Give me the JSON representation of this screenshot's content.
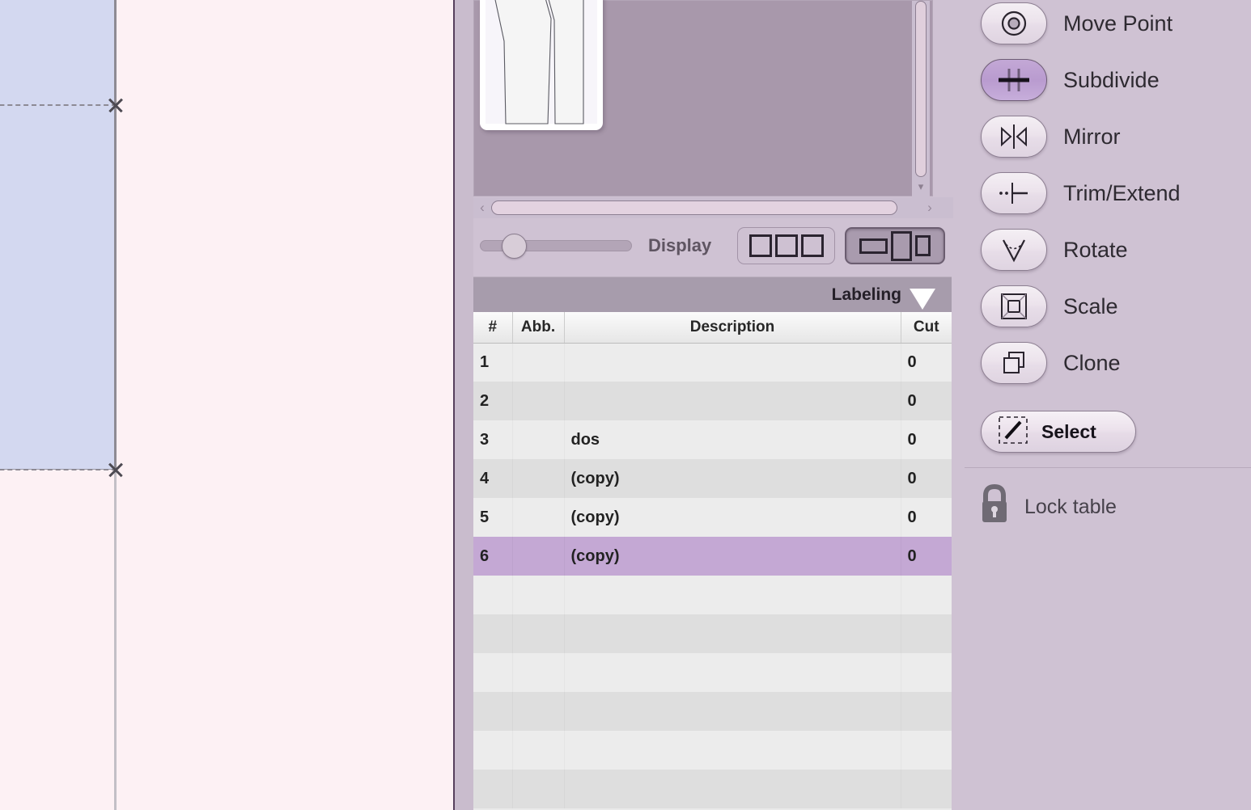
{
  "app": {
    "name": "pattern-layout-editor"
  },
  "canvas": {
    "selection_fill": "#d3d8f0",
    "background": "#fdf1f4",
    "marker_icons": [
      "x-marker",
      "x-marker"
    ]
  },
  "preview": {
    "background": "#a898ab",
    "sheet_label": "",
    "scroll_down_icon": "▾",
    "scroll_left_icon": "‹",
    "scroll_right_icon": "›"
  },
  "display_bar": {
    "label": "Display",
    "slider_value": "15",
    "view_modes": [
      {
        "name": "equal-columns-view",
        "selected": false
      },
      {
        "name": "mixed-columns-view",
        "selected": true
      }
    ]
  },
  "labeling": {
    "title": "Labeling",
    "collapse_icon": "triangle-down"
  },
  "table": {
    "columns": [
      "#",
      "Abb.",
      "Description",
      "Cut"
    ],
    "rows": [
      {
        "num": "1",
        "abb": "",
        "desc": "",
        "cut": "0",
        "selected": false
      },
      {
        "num": "2",
        "abb": "",
        "desc": "",
        "cut": "0",
        "selected": false
      },
      {
        "num": "3",
        "abb": "",
        "desc": "dos",
        "cut": "0",
        "selected": false
      },
      {
        "num": "4",
        "abb": "",
        "desc": "(copy)",
        "cut": "0",
        "selected": false
      },
      {
        "num": "5",
        "abb": "",
        "desc": "(copy)",
        "cut": "0",
        "selected": false
      },
      {
        "num": "6",
        "abb": "",
        "desc": "(copy)",
        "cut": "0",
        "selected": true
      },
      {
        "num": "",
        "abb": "",
        "desc": "",
        "cut": "",
        "selected": false
      },
      {
        "num": "",
        "abb": "",
        "desc": "",
        "cut": "",
        "selected": false
      },
      {
        "num": "",
        "abb": "",
        "desc": "",
        "cut": "",
        "selected": false
      },
      {
        "num": "",
        "abb": "",
        "desc": "",
        "cut": "",
        "selected": false
      },
      {
        "num": "",
        "abb": "",
        "desc": "",
        "cut": "",
        "selected": false
      },
      {
        "num": "",
        "abb": "",
        "desc": "",
        "cut": "",
        "selected": false
      }
    ],
    "selected_row_color": "#c4a8d4"
  },
  "tools": {
    "items": [
      {
        "label": "Move Point",
        "icon": "target-circles-icon",
        "active": false
      },
      {
        "label": "Subdivide",
        "icon": "plus-cross-icon",
        "active": true
      },
      {
        "label": "Mirror",
        "icon": "mirror-arrows-icon",
        "active": false
      },
      {
        "label": "Trim/Extend",
        "icon": "trim-extend-icon",
        "active": false
      },
      {
        "label": "Rotate",
        "icon": "rotate-angle-icon",
        "active": false
      },
      {
        "label": "Scale",
        "icon": "scale-square-icon",
        "active": false
      },
      {
        "label": "Clone",
        "icon": "clone-squares-icon",
        "active": false
      }
    ],
    "select_button": {
      "label": "Select",
      "icon": "select-marquee-icon"
    },
    "active_color": "#b99bcf"
  },
  "lock": {
    "label": "Lock table",
    "icon": "padlock-icon"
  },
  "cursor": {
    "icon": "mouse-pointer-icon"
  }
}
